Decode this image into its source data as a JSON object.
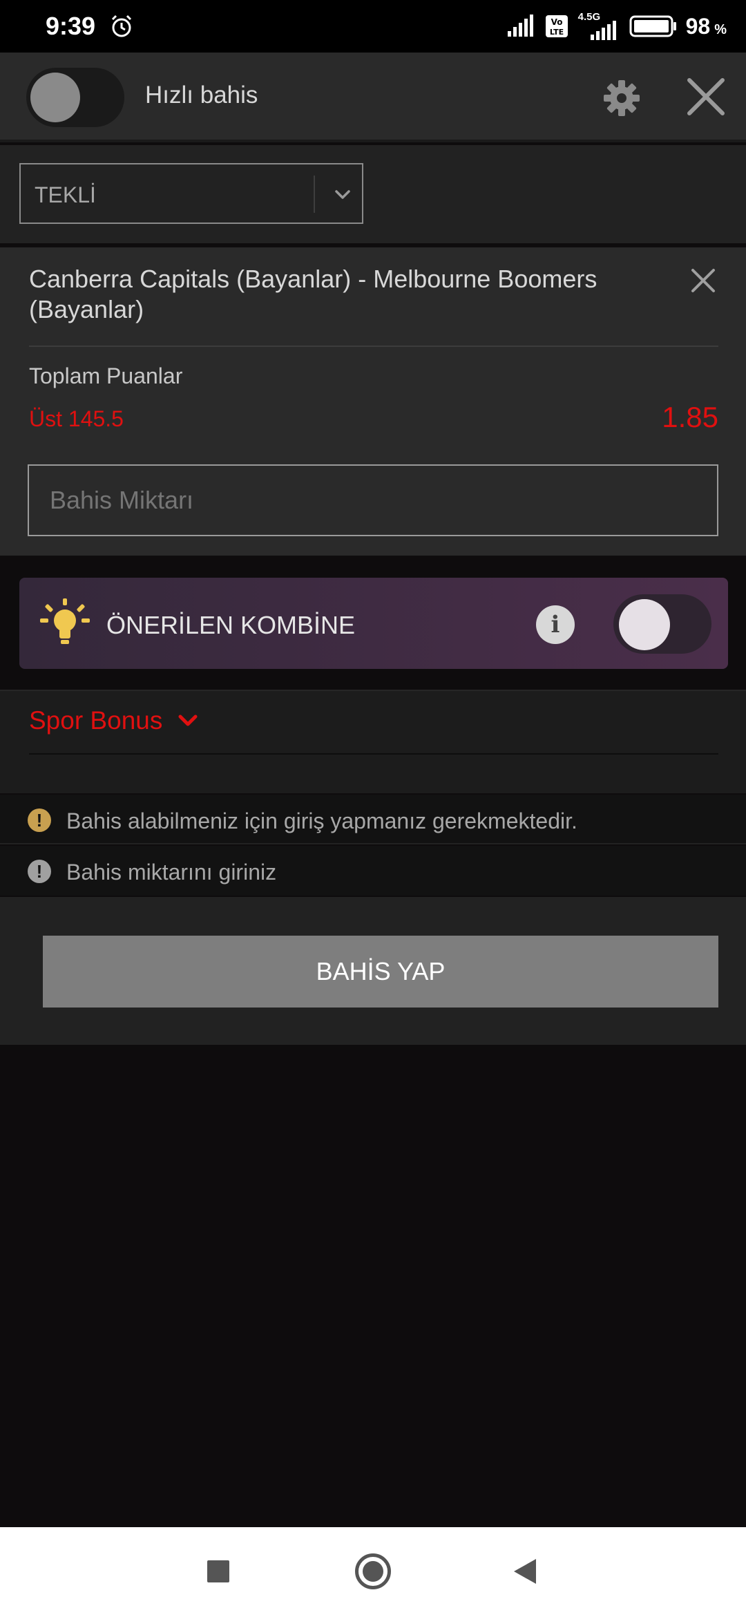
{
  "status_bar": {
    "time": "9:39",
    "network_label": "4.5G",
    "battery": "98",
    "battery_unit": "%"
  },
  "header": {
    "quick_bet_label": "Hızlı bahis",
    "quick_bet_enabled": false
  },
  "bet_type": {
    "selected": "TEKLİ"
  },
  "bet_card": {
    "match": "Canberra Capitals (Bayanlar) - Melbourne Boomers (Bayanlar)",
    "market": "Toplam Puanlar",
    "selection": "Üst 145.5",
    "odds": "1.85",
    "stake_placeholder": "Bahis Miktarı"
  },
  "combo": {
    "label": "ÖNERİLEN KOMBİNE",
    "enabled": false
  },
  "bonus": {
    "label": "Spor Bonus"
  },
  "messages": [
    {
      "text": "Bahis alabilmeniz için giriş yapmanız gerekmektedir.",
      "color": "#c8a050"
    },
    {
      "text": "Bahis miktarını giriniz",
      "color": "#a0a0a0"
    }
  ],
  "place_bet": {
    "label": "BAHİS YAP"
  },
  "colors": {
    "accent_red": "#e01010",
    "button_gray": "#7e7e7e"
  }
}
